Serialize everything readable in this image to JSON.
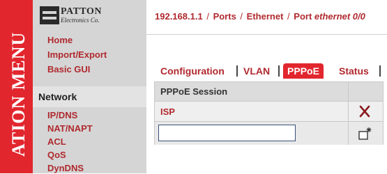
{
  "side_band": {
    "text": "ATION MENU"
  },
  "logo": {
    "title": "PATTON",
    "subtitle": "Electronics Co."
  },
  "menu": {
    "top_items": [
      "Home",
      "Import/Export",
      "Basic GUI"
    ],
    "section_header": "Network",
    "section_items": [
      "IP/DNS",
      "NAT/NAPT",
      "ACL",
      "QoS",
      "DynDNS"
    ]
  },
  "breadcrumb": {
    "host": "192.168.1.1",
    "sep": "/",
    "p1": "Ports",
    "p2": "Ethernet",
    "p3_prefix": "Port ",
    "p3_em": "ethernet 0/0"
  },
  "tabs": [
    {
      "label": "Configuration",
      "active": false
    },
    {
      "label": "VLAN",
      "active": false
    },
    {
      "label": "PPPoE",
      "active": true
    },
    {
      "label": "Status",
      "active": false
    }
  ],
  "table": {
    "header": "PPPoE Session",
    "rows": [
      {
        "name": "ISP"
      }
    ],
    "new_entry": {
      "value": "",
      "placeholder": ""
    }
  },
  "icons": {
    "delete": "close-icon",
    "add": "add-new-icon"
  },
  "colors": {
    "accent_red": "#e2262e",
    "link_red": "#b0292e",
    "panel_gray": "#d5d5d5"
  }
}
